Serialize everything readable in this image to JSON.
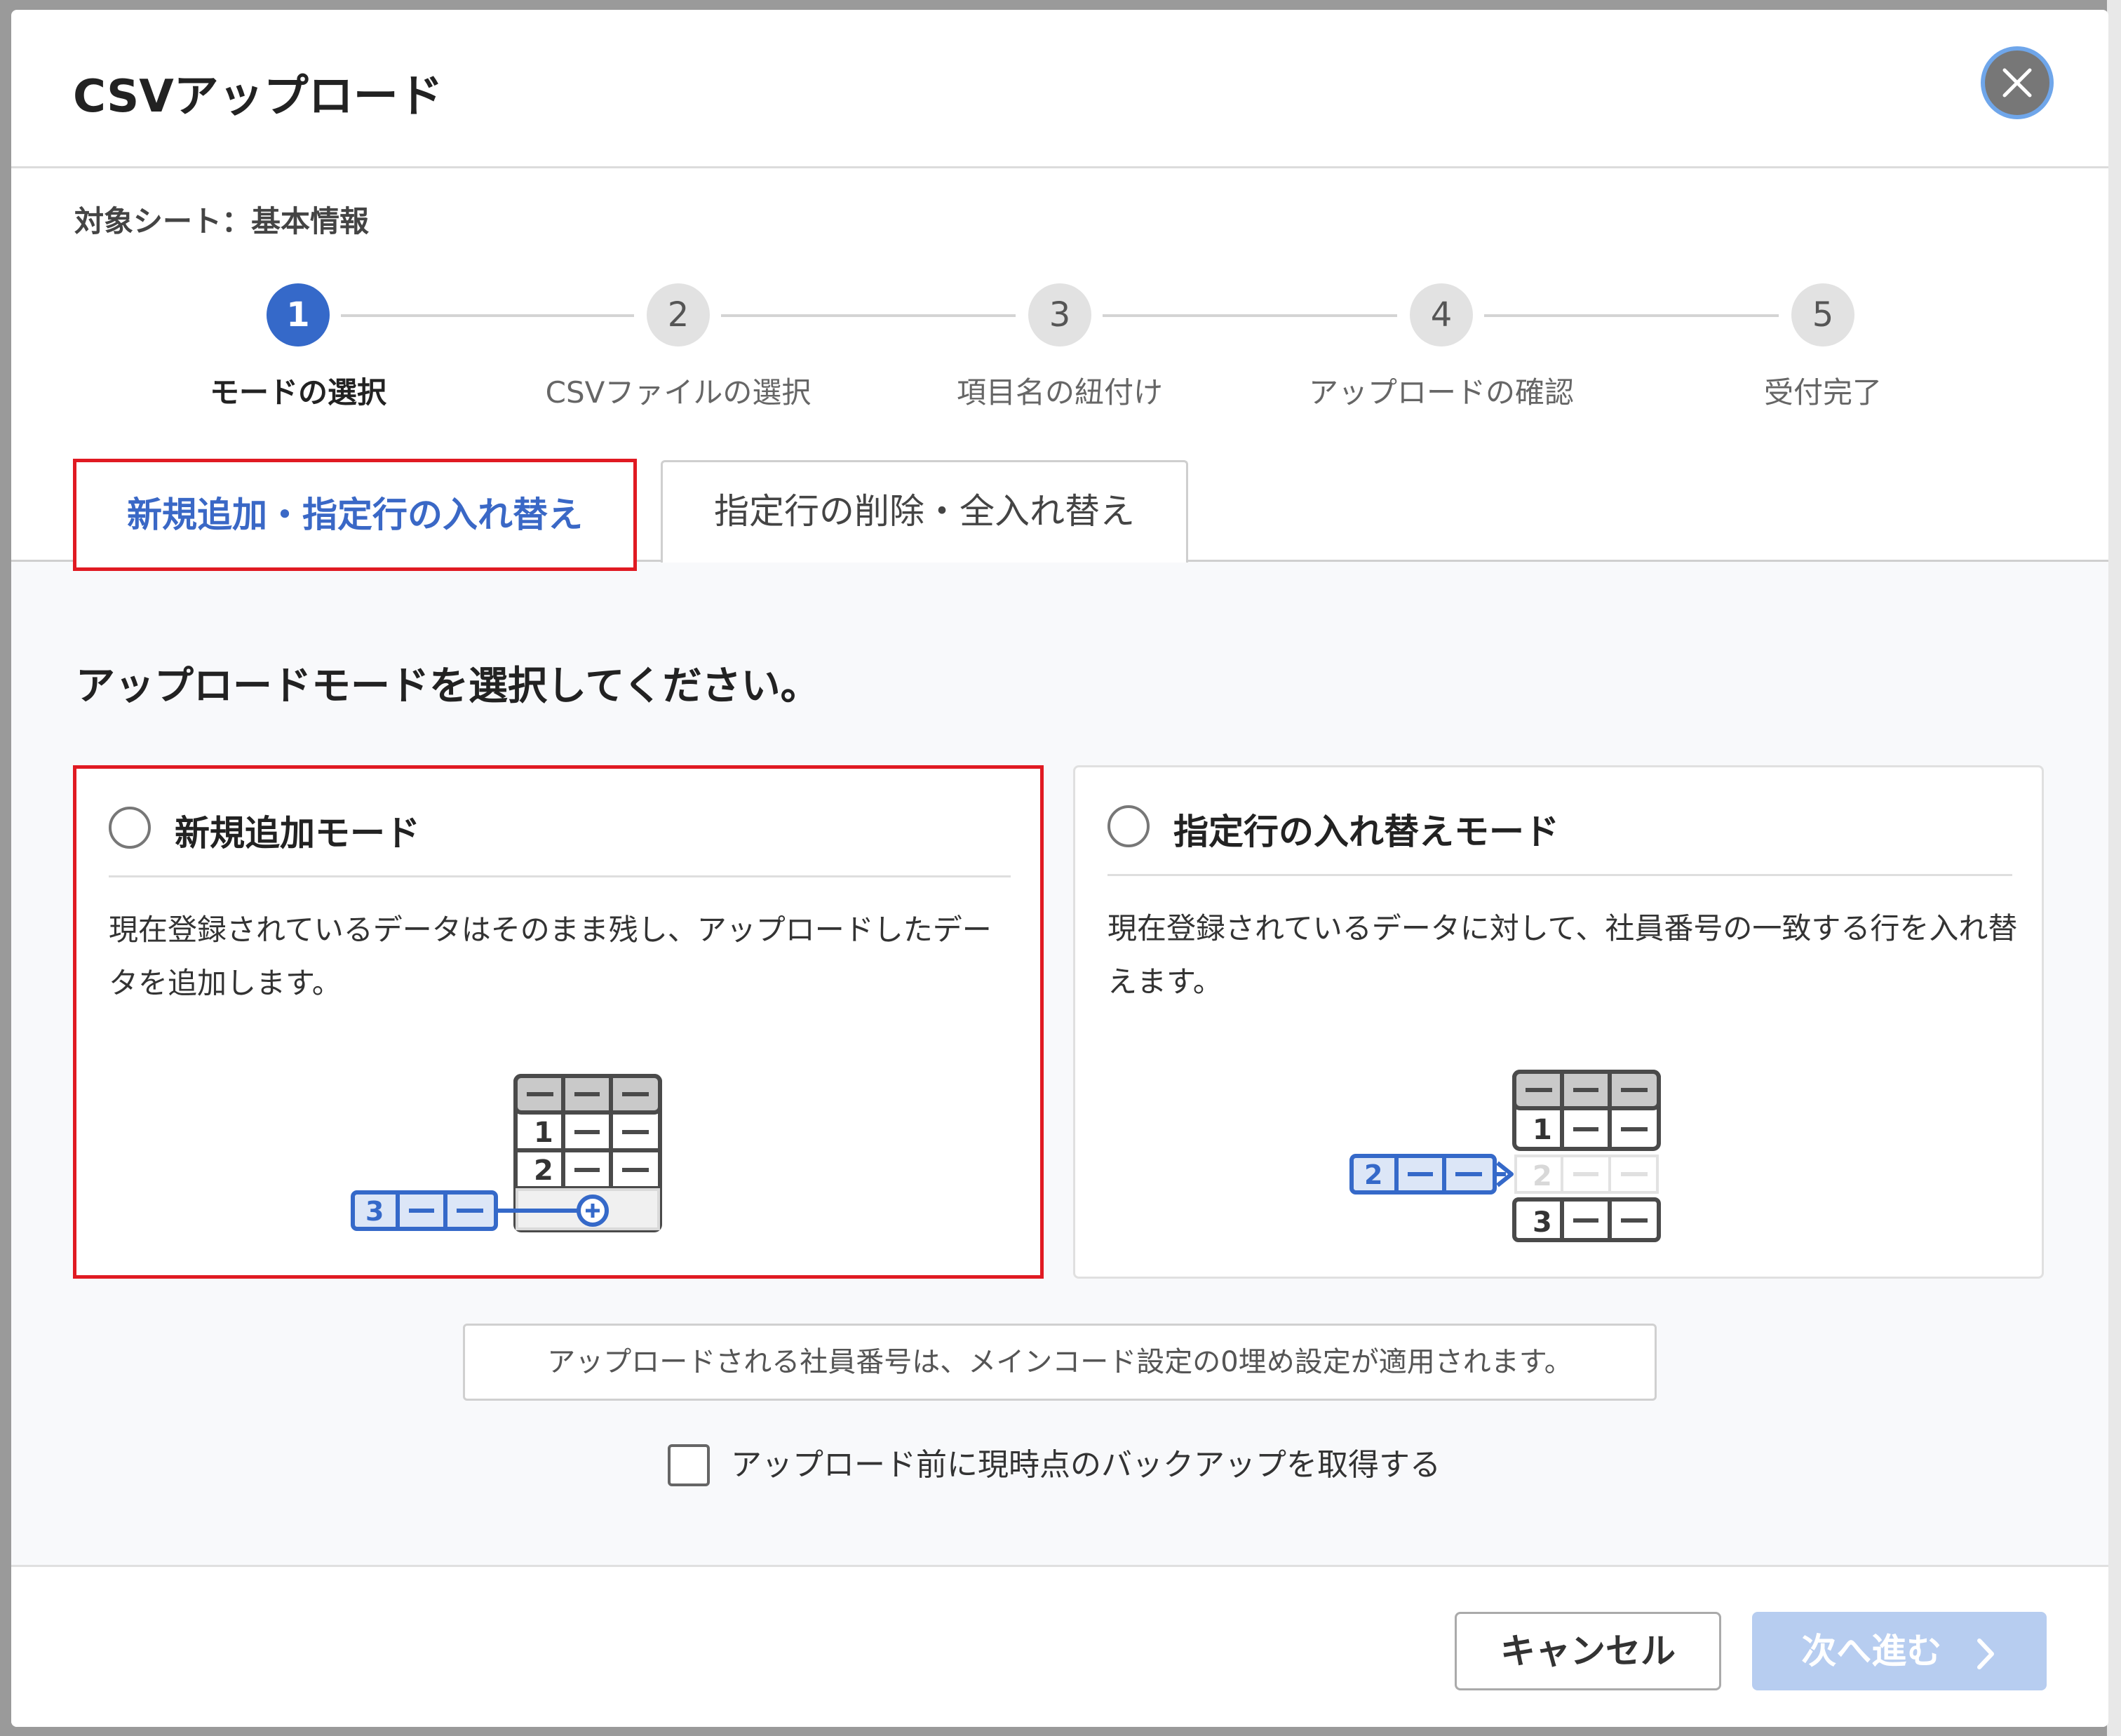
{
  "dialog": {
    "title": "CSVアップロード",
    "target_sheet": "対象シート：基本情報"
  },
  "steps": [
    {
      "number": "1",
      "label": "モードの選択",
      "active": true
    },
    {
      "number": "2",
      "label": "CSVファイルの選択",
      "active": false
    },
    {
      "number": "3",
      "label": "項目名の紐付け",
      "active": false
    },
    {
      "number": "4",
      "label": "アップロードの確認",
      "active": false
    },
    {
      "number": "5",
      "label": "受付完了",
      "active": false
    }
  ],
  "tabs": [
    {
      "label": "新規追加・指定行の入れ替え",
      "selected": true
    },
    {
      "label": "指定行の削除・全入れ替え",
      "selected": false
    }
  ],
  "main": {
    "prompt": "アップロードモードを選択してください。",
    "modes": [
      {
        "title": "新規追加モード",
        "description": "現在登録されているデータはそのまま残し、アップロードしたデータを追加します。",
        "checked": false
      },
      {
        "title": "指定行の入れ替えモード",
        "description": "現在登録されているデータに対して、社員番号の一致する行を入れ替えます。",
        "checked": false
      }
    ],
    "notice": "アップロードされる社員番号は、メインコード設定の0埋め設定が適用されます。",
    "backup_label": "アップロード前に現時点のバックアップを取得する",
    "backup_checked": false
  },
  "illustrations": {
    "append": {
      "rows": [
        "1",
        "2"
      ],
      "new_row": "3"
    },
    "replace": {
      "rows": [
        "1",
        "2",
        "3"
      ],
      "new_row": "2"
    }
  },
  "footer": {
    "cancel_label": "キャンセル",
    "next_label": "次へ進む"
  },
  "colors": {
    "accent": "#3569c9",
    "highlight_border": "#e01a22",
    "next_disabled": "#b7cdf0"
  }
}
